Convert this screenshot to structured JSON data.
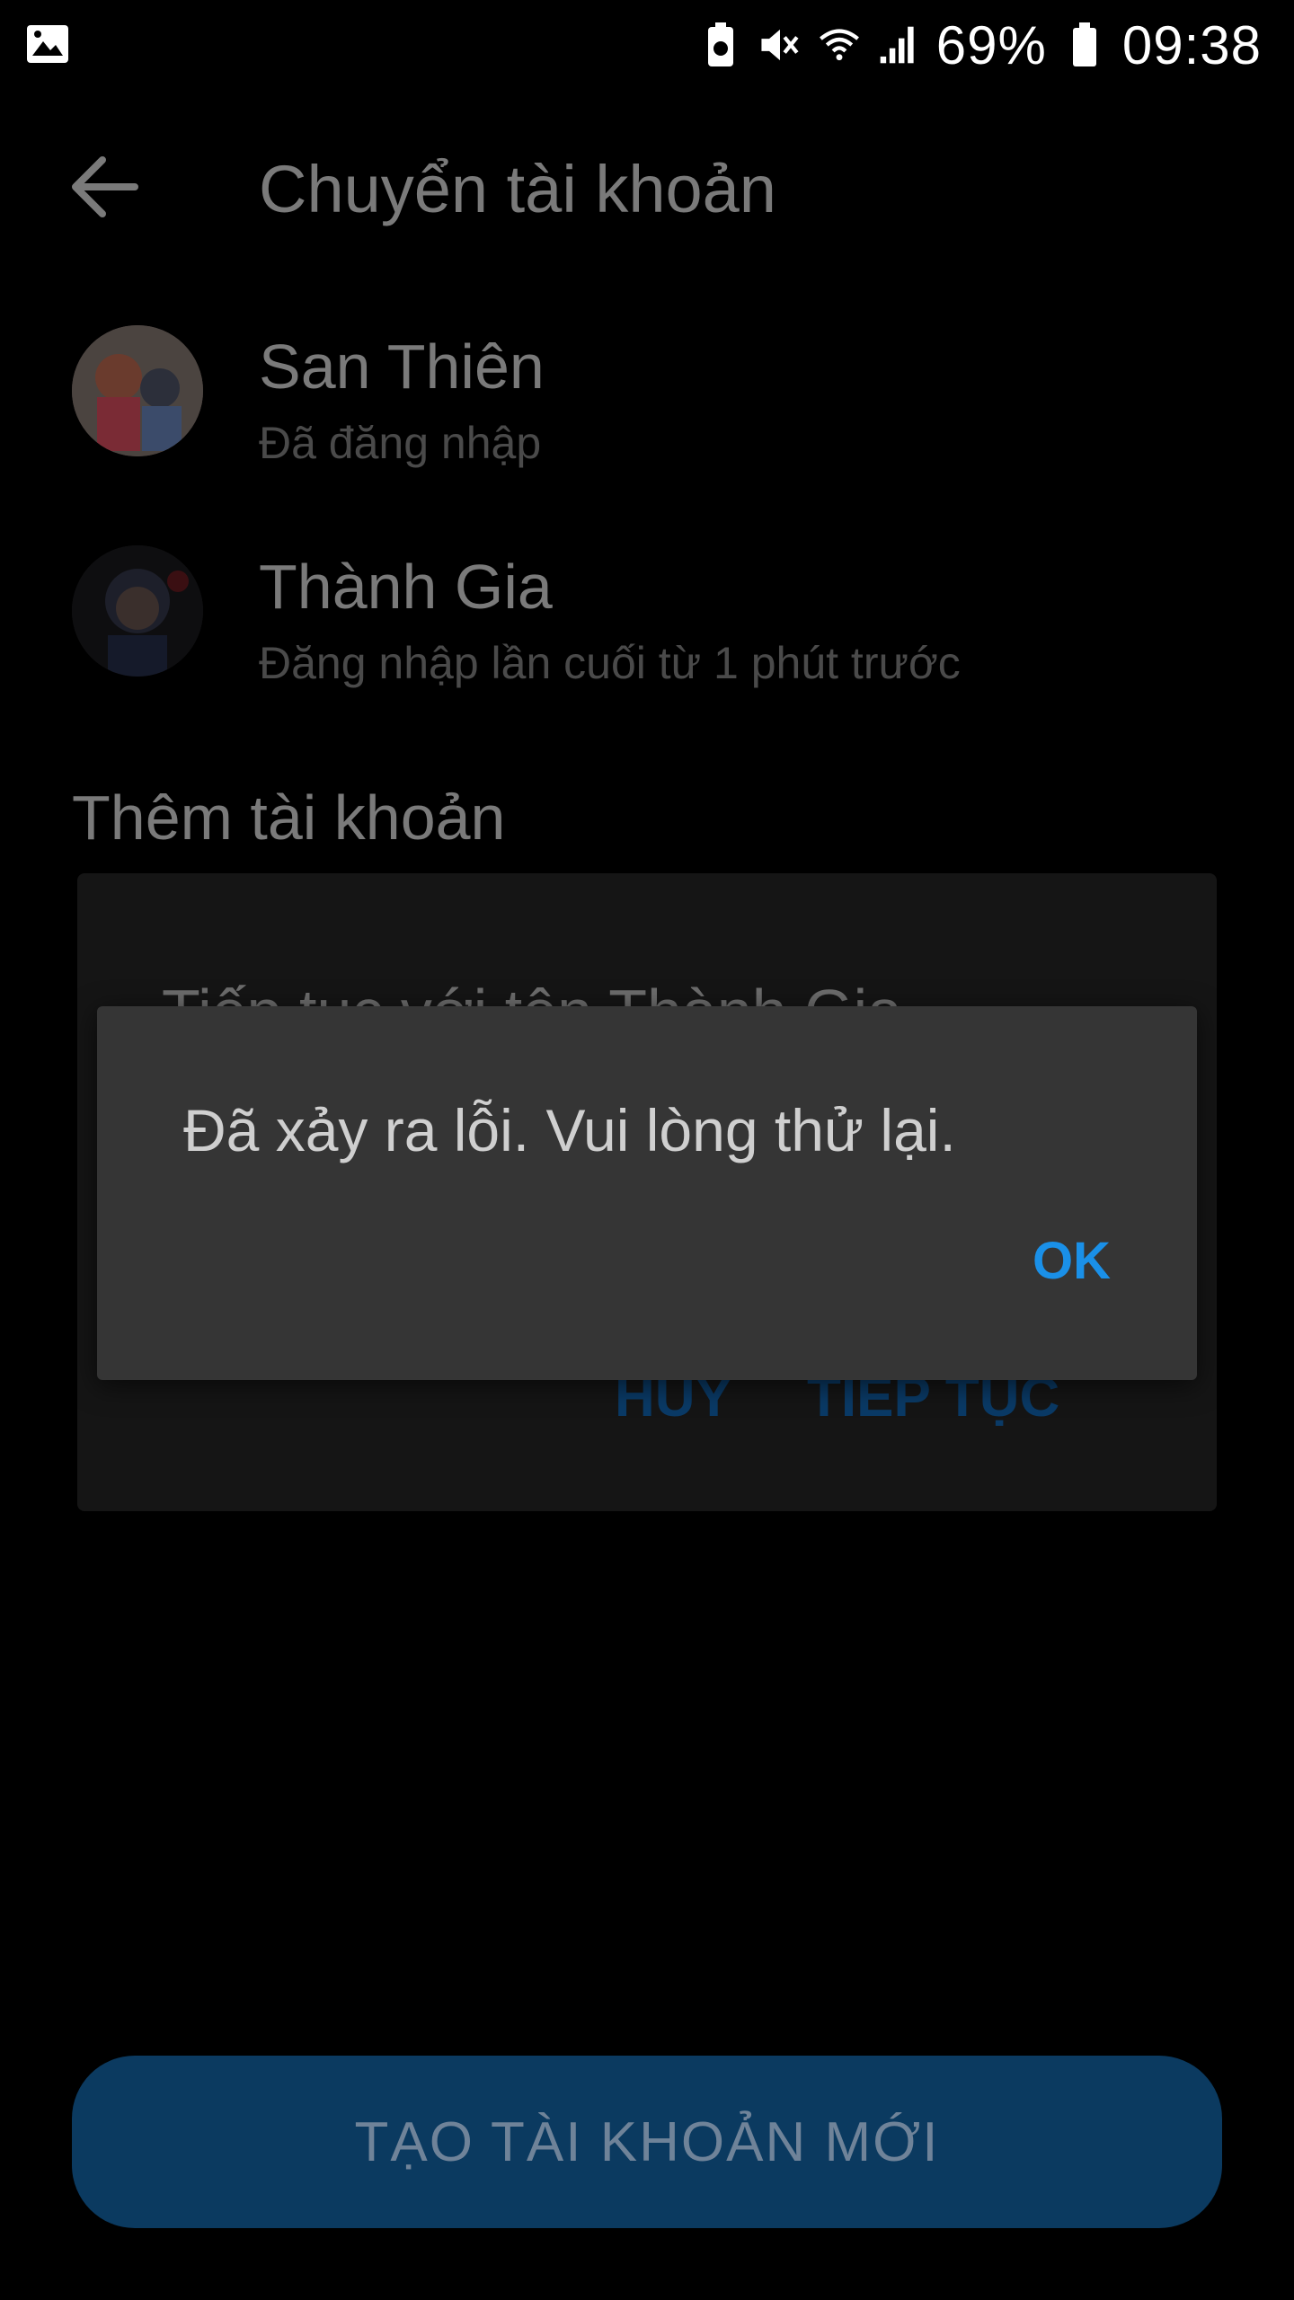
{
  "status_bar": {
    "battery_percent": "69%",
    "time": "09:38",
    "icons": [
      "gallery-icon",
      "battery-saver-icon",
      "mute-icon",
      "wifi-icon",
      "signal-icon",
      "battery-icon"
    ]
  },
  "header": {
    "back_icon": "arrow-left-icon",
    "title": "Chuyển tài khoản"
  },
  "accounts": [
    {
      "name": "San Thiên",
      "status": "Đã đăng nhập"
    },
    {
      "name": "Thành Gia",
      "status": "Đăng nhập lần cuối từ 1 phút trước"
    }
  ],
  "add_account": {
    "section_title": "Thêm tài khoản",
    "peek_text": "Tiếp tục với tên Thành Gia",
    "cancel_label": "HỦY",
    "continue_label": "TIẾP TỤC"
  },
  "create_button": {
    "label": "TẠO TÀI KHOẢN MỚI"
  },
  "dialog": {
    "message": "Đã xảy ra lỗi. Vui lòng thử lại.",
    "ok_label": "OK"
  },
  "colors": {
    "accent": "#1a90e8",
    "dialog_bg": "#353535",
    "background": "#000000"
  }
}
